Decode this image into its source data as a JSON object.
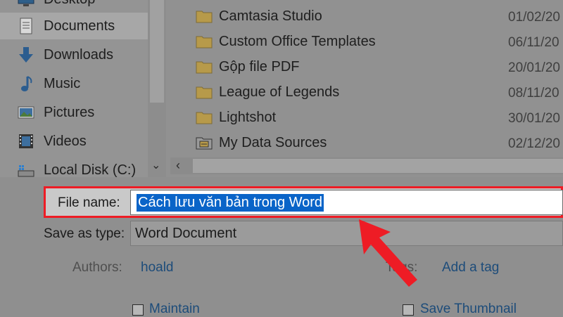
{
  "nav": {
    "items": [
      {
        "label": "Desktop",
        "icon": "desktop-icon"
      },
      {
        "label": "Documents",
        "icon": "documents-icon",
        "selected": true
      },
      {
        "label": "Downloads",
        "icon": "downloads-icon"
      },
      {
        "label": "Music",
        "icon": "music-icon"
      },
      {
        "label": "Pictures",
        "icon": "pictures-icon"
      },
      {
        "label": "Videos",
        "icon": "videos-icon"
      },
      {
        "label": "Local Disk (C:)",
        "icon": "local-disk-icon"
      }
    ]
  },
  "files": [
    {
      "name": "Camtasia Studio",
      "date": "01/02/20",
      "icon": "folder-icon"
    },
    {
      "name": "Custom Office Templates",
      "date": "06/11/20",
      "icon": "folder-icon"
    },
    {
      "name": "Gộp file PDF",
      "date": "20/01/20",
      "icon": "folder-icon"
    },
    {
      "name": "League of Legends",
      "date": "08/11/20",
      "icon": "folder-icon"
    },
    {
      "name": "Lightshot",
      "date": "30/01/20",
      "icon": "folder-icon"
    },
    {
      "name": "My Data Sources",
      "date": "02/12/20",
      "icon": "data-sources-folder-icon"
    }
  ],
  "form": {
    "file_name_label": "File name:",
    "file_name_value": "Cách lưu văn bản trong Word",
    "save_type_label": "Save as type:",
    "save_type_value": "Word Document",
    "authors_label": "Authors:",
    "authors_value": "hoald",
    "tags_label": "Tags:",
    "tags_value": "Add a tag",
    "maintain_label": "Maintain",
    "save_thumbnail_label": "Save Thumbnail"
  },
  "colors": {
    "highlight_border": "#ee1c25",
    "selection": "#0a64c8",
    "arrow": "#ee1c25"
  }
}
